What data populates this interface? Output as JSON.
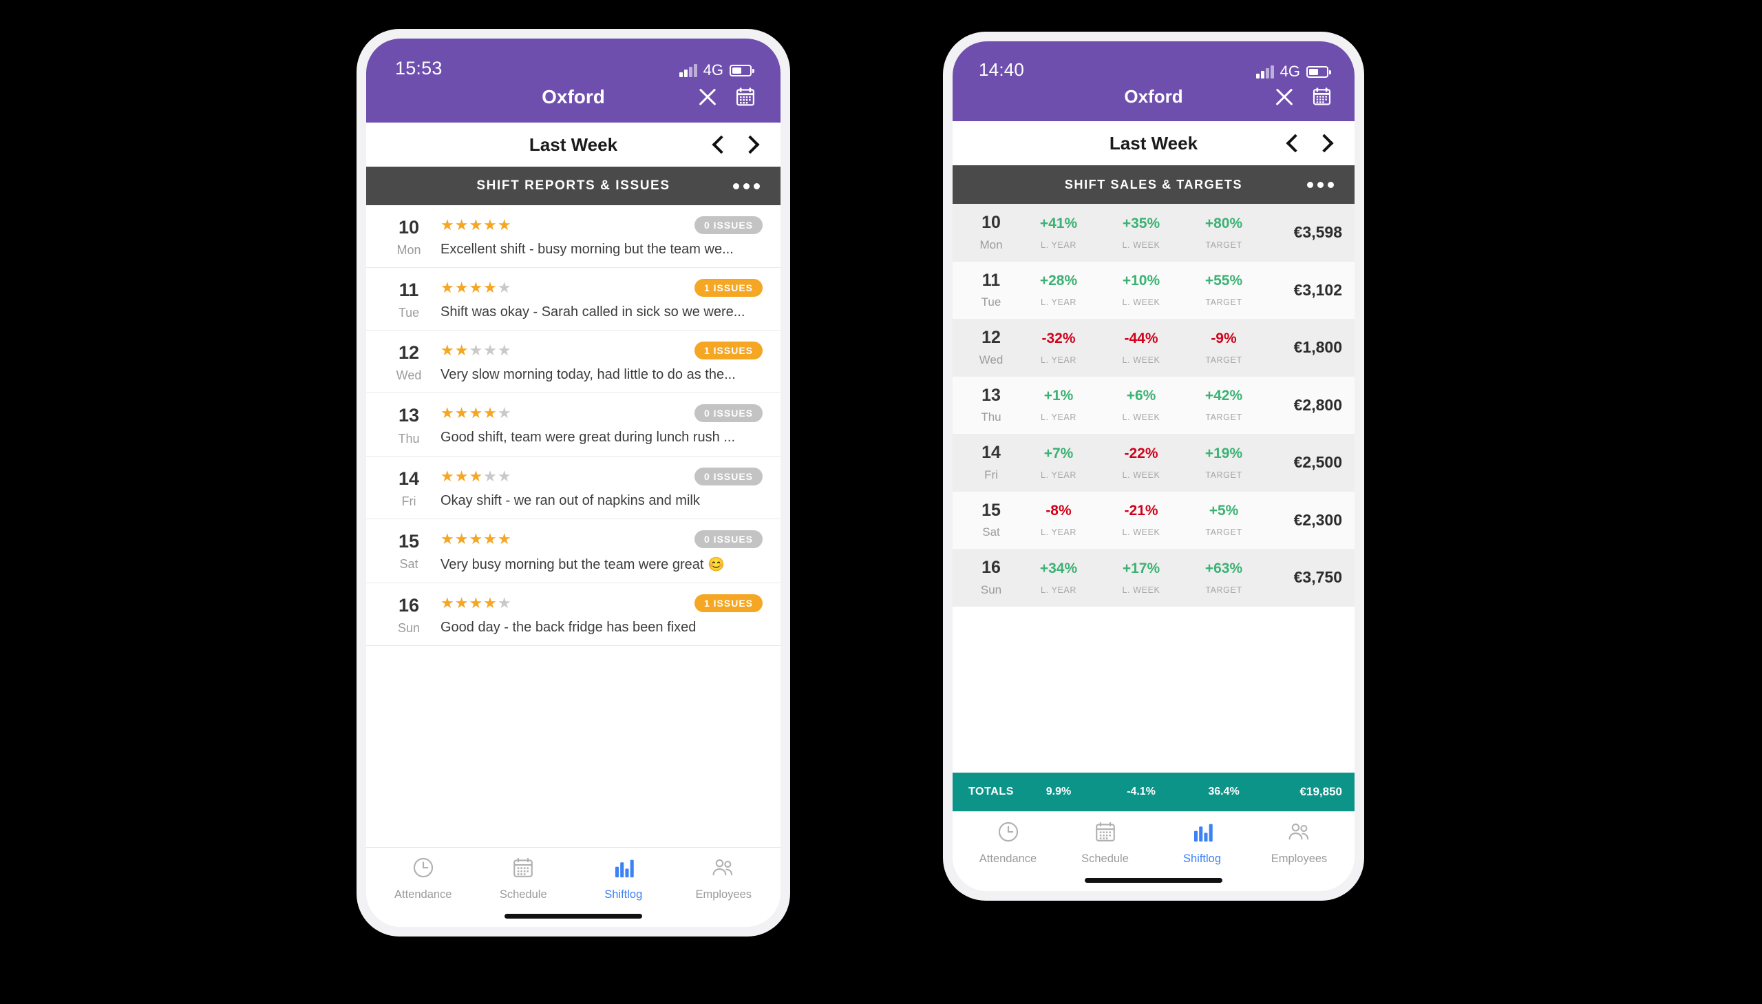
{
  "colors": {
    "purple": "#6f4fae",
    "section_gray": "#4a4a4a",
    "star_orange": "#f5a623",
    "badge_gray": "#c3c3c3",
    "positive_green": "#3bb273",
    "negative_red": "#d0021b",
    "totals_teal": "#0d9488",
    "tab_active_blue": "#3b82f6"
  },
  "left_phone": {
    "status": {
      "time": "15:53",
      "network": "4G"
    },
    "nav": {
      "title": "Oxford",
      "close_icon": "close-icon",
      "calendar_icon": "calendar-icon"
    },
    "week": {
      "label": "Last Week",
      "prev_icon": "chevron-left-icon",
      "next_icon": "chevron-right-icon"
    },
    "section": {
      "title": "SHIFT REPORTS & ISSUES",
      "more_icon": "more-options-icon"
    },
    "rows": [
      {
        "date": "10",
        "day": "Mon",
        "rating": 5,
        "issues": "0 ISSUES",
        "issues_count": 0,
        "text": "Excellent shift - busy morning but the team we..."
      },
      {
        "date": "11",
        "day": "Tue",
        "rating": 4,
        "issues": "1 ISSUES",
        "issues_count": 1,
        "text": "Shift was okay - Sarah called in sick so we were..."
      },
      {
        "date": "12",
        "day": "Wed",
        "rating": 2,
        "issues": "1 ISSUES",
        "issues_count": 1,
        "text": "Very slow morning today, had little to do as the..."
      },
      {
        "date": "13",
        "day": "Thu",
        "rating": 4,
        "issues": "0 ISSUES",
        "issues_count": 0,
        "text": "Good shift, team were great during lunch rush ..."
      },
      {
        "date": "14",
        "day": "Fri",
        "rating": 3,
        "issues": "0 ISSUES",
        "issues_count": 0,
        "text": "Okay shift - we ran out of napkins and milk"
      },
      {
        "date": "15",
        "day": "Sat",
        "rating": 5,
        "issues": "0 ISSUES",
        "issues_count": 0,
        "text": "Very busy morning but the team were great 😊"
      },
      {
        "date": "16",
        "day": "Sun",
        "rating": 4,
        "issues": "1 ISSUES",
        "issues_count": 1,
        "text": "Good day - the back fridge has been fixed"
      }
    ],
    "tabs": [
      {
        "label": "Attendance",
        "icon": "clock-icon",
        "active": false
      },
      {
        "label": "Schedule",
        "icon": "calendar-icon",
        "active": false
      },
      {
        "label": "Shiftlog",
        "icon": "bar-chart-icon",
        "active": true
      },
      {
        "label": "Employees",
        "icon": "people-icon",
        "active": false
      }
    ]
  },
  "right_phone": {
    "status": {
      "time": "14:40",
      "network": "4G"
    },
    "nav": {
      "title": "Oxford",
      "close_icon": "close-icon",
      "calendar_icon": "calendar-icon"
    },
    "week": {
      "label": "Last Week",
      "prev_icon": "chevron-left-icon",
      "next_icon": "chevron-right-icon"
    },
    "section": {
      "title": "SHIFT SALES & TARGETS",
      "more_icon": "more-options-icon"
    },
    "metric_labels": {
      "last_year": "L. YEAR",
      "last_week": "L. WEEK",
      "target": "TARGET"
    },
    "rows": [
      {
        "date": "10",
        "day": "Mon",
        "l_year": "+41%",
        "l_week": "+35%",
        "target": "+80%",
        "total": "€3,598"
      },
      {
        "date": "11",
        "day": "Tue",
        "l_year": "+28%",
        "l_week": "+10%",
        "target": "+55%",
        "total": "€3,102"
      },
      {
        "date": "12",
        "day": "Wed",
        "l_year": "-32%",
        "l_week": "-44%",
        "target": "-9%",
        "total": "€1,800"
      },
      {
        "date": "13",
        "day": "Thu",
        "l_year": "+1%",
        "l_week": "+6%",
        "target": "+42%",
        "total": "€2,800"
      },
      {
        "date": "14",
        "day": "Fri",
        "l_year": "+7%",
        "l_week": "-22%",
        "target": "+19%",
        "total": "€2,500"
      },
      {
        "date": "15",
        "day": "Sat",
        "l_year": "-8%",
        "l_week": "-21%",
        "target": "+5%",
        "total": "€2,300"
      },
      {
        "date": "16",
        "day": "Sun",
        "l_year": "+34%",
        "l_week": "+17%",
        "target": "+63%",
        "total": "€3,750"
      }
    ],
    "totals": {
      "label": "TOTALS",
      "l_year": "9.9%",
      "l_week": "-4.1%",
      "target": "36.4%",
      "total": "€19,850"
    },
    "tabs": [
      {
        "label": "Attendance",
        "icon": "clock-icon",
        "active": false
      },
      {
        "label": "Schedule",
        "icon": "calendar-icon",
        "active": false
      },
      {
        "label": "Shiftlog",
        "icon": "bar-chart-icon",
        "active": true
      },
      {
        "label": "Employees",
        "icon": "people-icon",
        "active": false
      }
    ]
  }
}
